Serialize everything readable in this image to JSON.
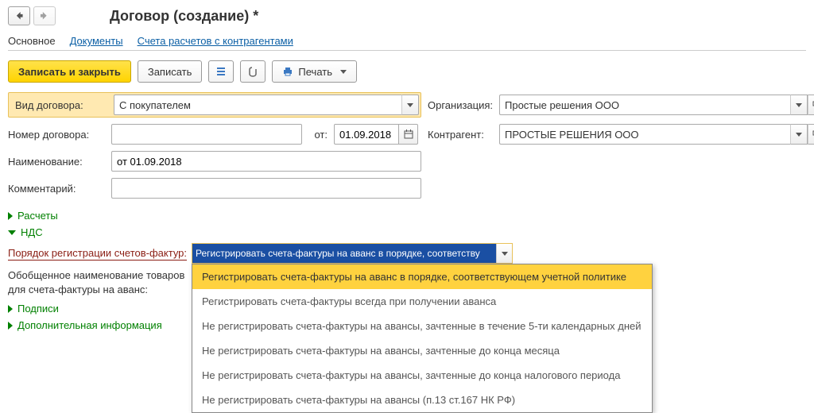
{
  "header": {
    "title": "Договор (создание) *"
  },
  "tabs": {
    "main": "Основное",
    "documents": "Документы",
    "accounts": "Счета расчетов с контрагентами"
  },
  "toolbar": {
    "saveAndClose": "Записать и закрыть",
    "save": "Записать",
    "print": "Печать"
  },
  "labels": {
    "contractType": "Вид договора:",
    "organization": "Организация:",
    "contractNumber": "Номер договора:",
    "from": "от:",
    "counterparty": "Контрагент:",
    "name": "Наименование:",
    "comment": "Комментарий:",
    "calculations": "Расчеты",
    "vat": "НДС",
    "sfOrder": "Порядок регистрации счетов-фактур:",
    "generalizedNameL1": "Обобщенное наименование товаров",
    "generalizedNameL2": "для счета-фактуры на аванс:",
    "signatures": "Подписи",
    "additionalInfo": "Дополнительная информация"
  },
  "values": {
    "contractType": "С покупателем",
    "organization": "Простые решения ООО",
    "contractNumber": "",
    "date": "01.09.2018",
    "counterparty": "ПРОСТЫЕ РЕШЕНИЯ ООО",
    "name": "от 01.09.2018",
    "comment": "",
    "sfSelected": "Регистрировать счета-фактуры на аванс в порядке, соответству"
  },
  "dropdown": {
    "opt0": "Регистрировать счета-фактуры на аванс в порядке, соответствующем учетной политике",
    "opt1": "Регистрировать счета-фактуры всегда при получении аванса",
    "opt2": "Не регистрировать счета-фактуры на авансы, зачтенные в течение 5-ти календарных дней",
    "opt3": "Не регистрировать счета-фактуры на авансы, зачтенные до конца месяца",
    "opt4": "Не регистрировать счета-фактуры на авансы, зачтенные до конца налогового периода",
    "opt5": "Не регистрировать счета-фактуры на авансы (п.13 ст.167 НК РФ)"
  }
}
